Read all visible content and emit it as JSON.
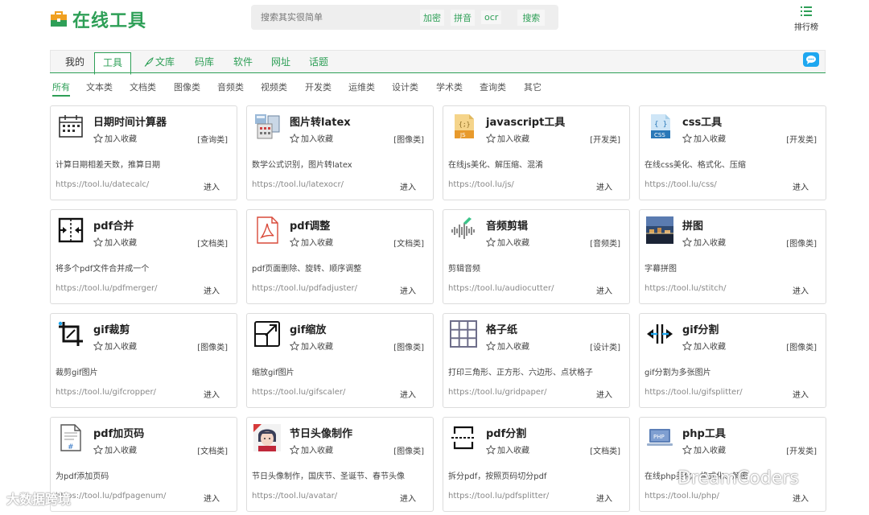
{
  "header": {
    "site_title": "在线工具",
    "search_placeholder": "搜索其实很简单",
    "search_tags": [
      "加密",
      "拼音",
      "ocr"
    ],
    "search_button": "搜索",
    "rank_label": "排行榜"
  },
  "tabs": [
    {
      "label": "我的"
    },
    {
      "label": "工具",
      "active": true
    },
    {
      "label": "文库"
    },
    {
      "label": "码库"
    },
    {
      "label": "软件"
    },
    {
      "label": "网址"
    },
    {
      "label": "话题"
    }
  ],
  "categories": [
    "所有",
    "文本类",
    "文档类",
    "图像类",
    "音频类",
    "视频类",
    "开发类",
    "运维类",
    "设计类",
    "学术类",
    "查询类",
    "其它"
  ],
  "favorite_label": "加入收藏",
  "enter_label": "进入",
  "cards": [
    {
      "title": "日期时间计算器",
      "category": "[查询类]",
      "desc": "计算日期相差天数，推算日期",
      "url": "https://tool.lu/datecalc/",
      "icon": "calendar-icon"
    },
    {
      "title": "图片转latex",
      "category": "[图像类]",
      "desc": "数学公式识别，图片转latex",
      "url": "https://tool.lu/latexocr/",
      "icon": "calculator-icon"
    },
    {
      "title": "javascript工具",
      "category": "[开发类]",
      "desc": "在线js美化、解压缩、混淆",
      "url": "https://tool.lu/js/",
      "icon": "js-file-icon"
    },
    {
      "title": "css工具",
      "category": "[开发类]",
      "desc": "在线css美化、格式化、压缩",
      "url": "https://tool.lu/css/",
      "icon": "css-file-icon"
    },
    {
      "title": "pdf合并",
      "category": "[文档类]",
      "desc": "将多个pdf文件合并成一个",
      "url": "https://tool.lu/pdfmerger/",
      "icon": "merge-icon"
    },
    {
      "title": "pdf调整",
      "category": "[文档类]",
      "desc": "pdf页面删除、旋转、顺序调整",
      "url": "https://tool.lu/pdfadjuster/",
      "icon": "pdf-file-icon"
    },
    {
      "title": "音频剪辑",
      "category": "[音频类]",
      "desc": "剪辑音频",
      "url": "https://tool.lu/audiocutter/",
      "icon": "audio-wave-icon"
    },
    {
      "title": "拼图",
      "category": "[图像类]",
      "desc": "字幕拼图",
      "url": "https://tool.lu/stitch/",
      "icon": "stitch-photo-icon"
    },
    {
      "title": "gif裁剪",
      "category": "[图像类]",
      "desc": "裁剪gif图片",
      "url": "https://tool.lu/gifcropper/",
      "icon": "crop-icon"
    },
    {
      "title": "gif缩放",
      "category": "[图像类]",
      "desc": "缩放gif图片",
      "url": "https://tool.lu/gifscaler/",
      "icon": "resize-icon"
    },
    {
      "title": "格子纸",
      "category": "[设计类]",
      "desc": "打印三角形、正方形、六边形、点状格子",
      "url": "https://tool.lu/gridpaper/",
      "icon": "grid-icon"
    },
    {
      "title": "gif分割",
      "category": "[图像类]",
      "desc": "gif分割为多张图片",
      "url": "https://tool.lu/gifsplitter/",
      "icon": "split-icon"
    },
    {
      "title": "pdf加页码",
      "category": "[文档类]",
      "desc": "为pdf添加页码",
      "url": "https://tool.lu/pdfpagenum/",
      "icon": "page-number-icon"
    },
    {
      "title": "节日头像制作",
      "category": "[图像类]",
      "desc": "节日头像制作，国庆节、圣诞节、春节头像",
      "url": "https://tool.lu/avatar/",
      "icon": "avatar-photo-icon"
    },
    {
      "title": "pdf分割",
      "category": "[文档类]",
      "desc": "拆分pdf，按照页码切分pdf",
      "url": "https://tool.lu/pdfsplitter/",
      "icon": "pdf-split-icon"
    },
    {
      "title": "php工具",
      "category": "[开发类]",
      "desc": "在线php美化、格式化、解密",
      "url": "https://tool.lu/php/",
      "icon": "php-laptop-icon"
    }
  ],
  "watermarks": {
    "left": "大数据跨境",
    "right": "DreamCoders"
  },
  "colors": {
    "brand": "#2e9f57",
    "chat": "#1ea7f0"
  }
}
